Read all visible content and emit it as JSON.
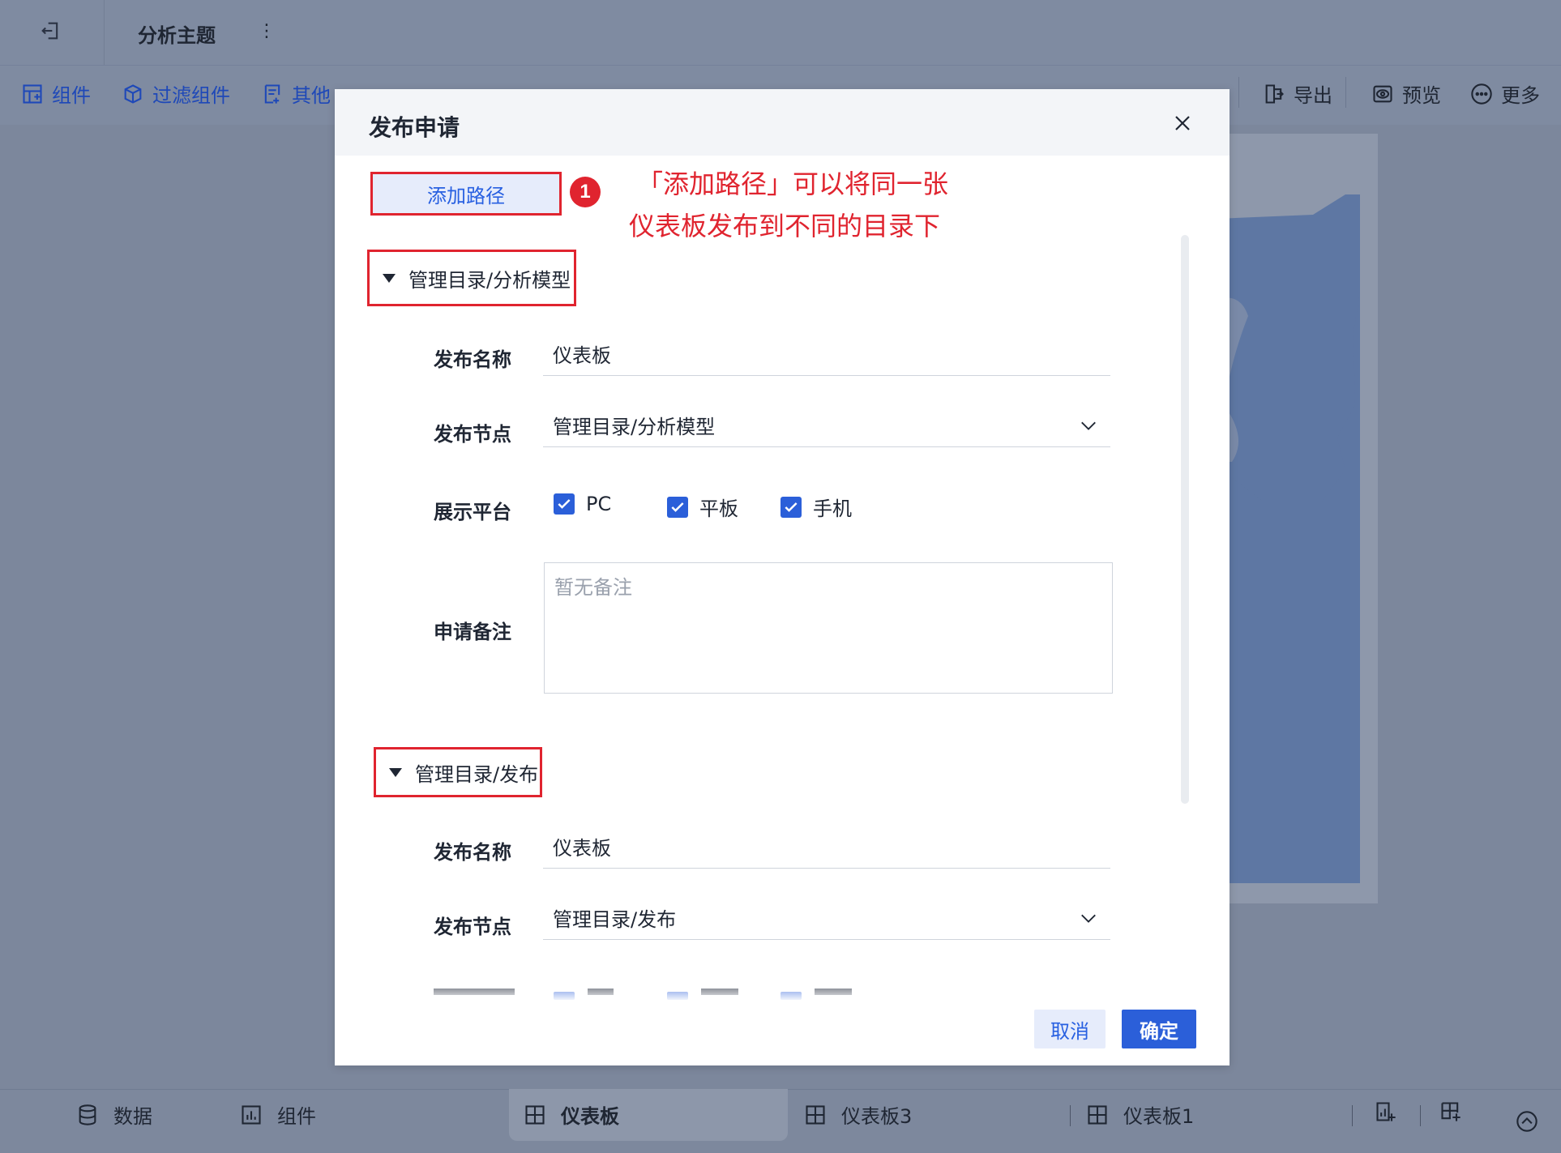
{
  "app": {
    "title": "分析主题"
  },
  "toolbar": {
    "left_items": [
      {
        "label": "组件",
        "icon": "component-icon"
      },
      {
        "label": "过滤组件",
        "icon": "filter-cube-icon"
      },
      {
        "label": "其他",
        "icon": "other-doc-icon"
      }
    ],
    "right_items": [
      {
        "label": "导出",
        "icon": "export-icon"
      },
      {
        "label": "预览",
        "icon": "preview-eye-icon"
      },
      {
        "label": "更多",
        "icon": "more-dots-icon"
      }
    ]
  },
  "modal": {
    "title": "发布申请",
    "add_path_label": "添加路径",
    "badge_number": "1",
    "annotation_line1": "「添加路径」可以将同一张",
    "annotation_line2": "仪表板发布到不同的目录下",
    "sections": [
      {
        "header": "管理目录/分析模型",
        "name_label": "发布名称",
        "name_value": "仪表板",
        "node_label": "发布节点",
        "node_value": "管理目录/分析模型",
        "platform_label": "展示平台",
        "platforms": [
          "PC",
          "平板",
          "手机"
        ],
        "remark_label": "申请备注",
        "remark_placeholder": "暂无备注"
      },
      {
        "header": "管理目录/发布",
        "name_label": "发布名称",
        "name_value": "仪表板",
        "node_label": "发布节点",
        "node_value": "管理目录/发布"
      }
    ],
    "cancel_label": "取消",
    "ok_label": "确定"
  },
  "bottom_tabs": [
    {
      "label": "数据",
      "icon": "database-icon"
    },
    {
      "label": "组件",
      "icon": "bar-chart-icon"
    },
    {
      "label": "仪表板",
      "icon": "dashboard-grid-icon",
      "active": true
    },
    {
      "label": "仪表板3",
      "icon": "dashboard-grid-icon"
    },
    {
      "label": "仪表板1",
      "icon": "dashboard-grid-icon"
    }
  ],
  "colors": {
    "accent": "#2b5fd9",
    "annotation": "#e0242f",
    "overlay": "#828c9e"
  }
}
